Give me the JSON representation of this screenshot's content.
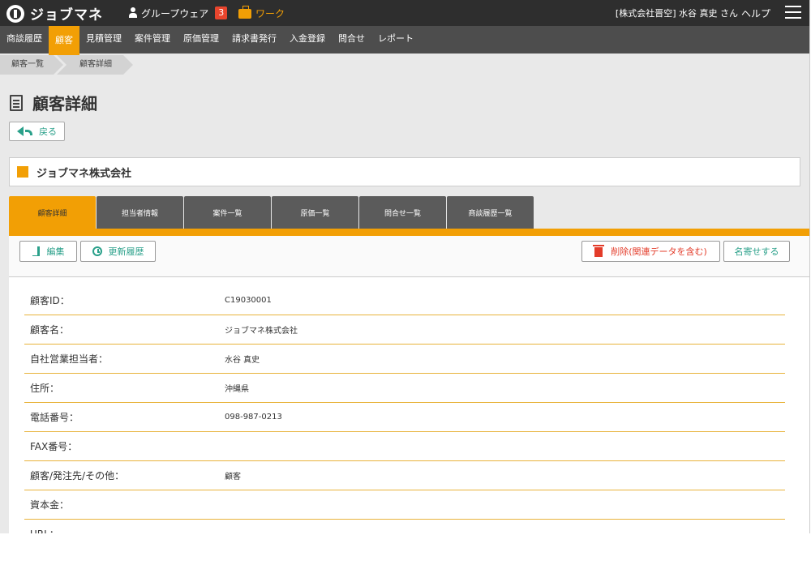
{
  "header": {
    "logo_text": "ジョブマネ",
    "groupware_label": "グループウェア",
    "groupware_badge": "3",
    "work_label": "ワーク",
    "user_label": "[株式会社晋空] 水谷 真史 さん",
    "help_label": "ヘルプ",
    "colors": {
      "bar": "#2e2e2e",
      "accent": "#f29f05",
      "badge": "#e9452d"
    }
  },
  "nav": {
    "items": [
      {
        "label": "商談履歴",
        "active": false
      },
      {
        "label": "顧客",
        "active": true
      },
      {
        "label": "見積管理",
        "active": false
      },
      {
        "label": "案件管理",
        "active": false
      },
      {
        "label": "原価管理",
        "active": false
      },
      {
        "label": "請求書発行",
        "active": false
      },
      {
        "label": "入金登録",
        "active": false
      },
      {
        "label": "問合せ",
        "active": false
      },
      {
        "label": "レポート",
        "active": false
      }
    ]
  },
  "breadcrumb": {
    "items": [
      "顧客一覧",
      "顧客詳細"
    ]
  },
  "page": {
    "title": "顧客詳細",
    "back_label": "戻る",
    "company_name": "ジョブマネ株式会社"
  },
  "tabs": [
    {
      "label": "顧客詳細",
      "active": true
    },
    {
      "label": "担当者情報",
      "active": false
    },
    {
      "label": "案件一覧",
      "active": false
    },
    {
      "label": "原価一覧",
      "active": false
    },
    {
      "label": "問合せ一覧",
      "active": false
    },
    {
      "label": "商談履歴一覧",
      "active": false
    }
  ],
  "toolbar": {
    "edit_label": "編集",
    "history_label": "更新履歴",
    "delete_label": "削除(関連データを含む)",
    "merge_label": "名寄せする"
  },
  "details": [
    {
      "label": "顧客ID：",
      "value": "C19030001"
    },
    {
      "label": "顧客名：",
      "value": "ジョブマネ株式会社"
    },
    {
      "label": "自社営業担当者：",
      "value": "水谷 真史"
    },
    {
      "label": "住所：",
      "value": "沖縄県"
    },
    {
      "label": "電話番号：",
      "value": "098-987-0213"
    },
    {
      "label": "FAX番号：",
      "value": ""
    },
    {
      "label": "顧客/発注先/その他：",
      "value": "顧客"
    },
    {
      "label": "資本金：",
      "value": ""
    },
    {
      "label": "URL：",
      "value": ""
    }
  ]
}
